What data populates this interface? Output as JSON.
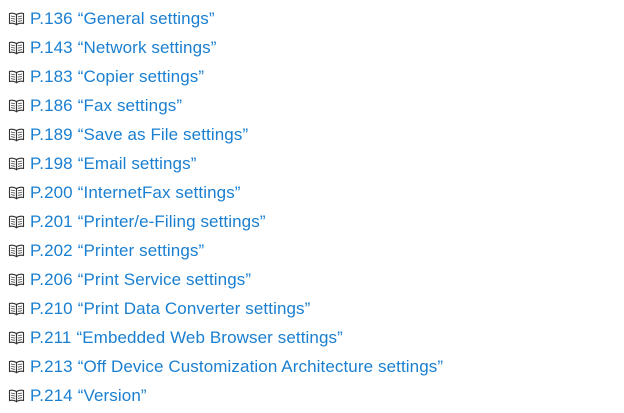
{
  "references": [
    {
      "page": "P.136",
      "title": "“General settings”"
    },
    {
      "page": "P.143",
      "title": "“Network settings”"
    },
    {
      "page": "P.183",
      "title": "“Copier settings”"
    },
    {
      "page": "P.186",
      "title": "“Fax settings”"
    },
    {
      "page": "P.189",
      "title": "“Save as File settings”"
    },
    {
      "page": "P.198",
      "title": "“Email settings”"
    },
    {
      "page": "P.200",
      "title": "“InternetFax settings”"
    },
    {
      "page": "P.201",
      "title": "“Printer/e-Filing settings”"
    },
    {
      "page": "P.202",
      "title": "“Printer settings”"
    },
    {
      "page": "P.206",
      "title": "“Print Service settings”"
    },
    {
      "page": "P.210",
      "title": "“Print Data Converter settings”"
    },
    {
      "page": "P.211",
      "title": "“Embedded Web Browser settings”"
    },
    {
      "page": "P.213",
      "title": "“Off Device Customization Architecture settings”"
    },
    {
      "page": "P.214",
      "title": "“Version”"
    }
  ],
  "icon": "open-book-icon",
  "colors": {
    "link": "#1a7fd0",
    "icon": "#333333"
  }
}
